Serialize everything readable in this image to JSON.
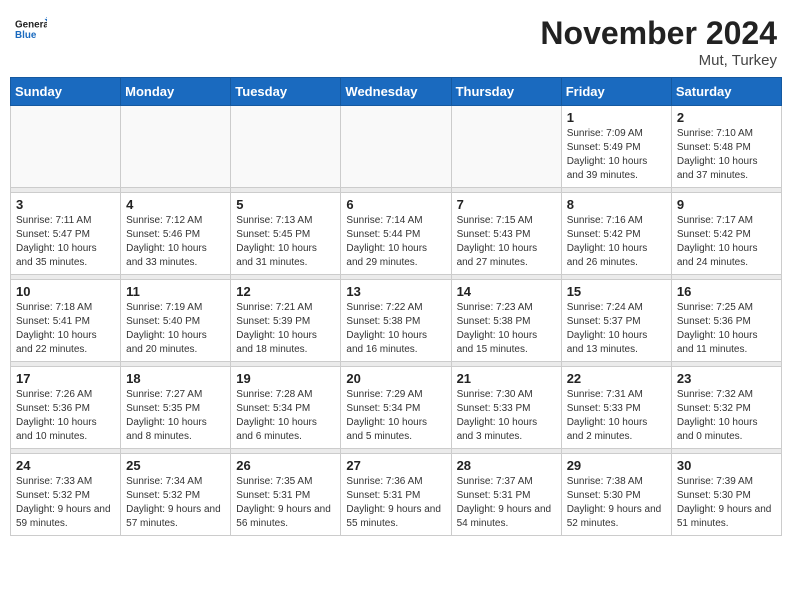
{
  "header": {
    "logo_text_general": "General",
    "logo_text_blue": "Blue",
    "month_title": "November 2024",
    "location": "Mut, Turkey"
  },
  "weekdays": [
    "Sunday",
    "Monday",
    "Tuesday",
    "Wednesday",
    "Thursday",
    "Friday",
    "Saturday"
  ],
  "weeks": [
    [
      {
        "day": "",
        "info": ""
      },
      {
        "day": "",
        "info": ""
      },
      {
        "day": "",
        "info": ""
      },
      {
        "day": "",
        "info": ""
      },
      {
        "day": "",
        "info": ""
      },
      {
        "day": "1",
        "info": "Sunrise: 7:09 AM\nSunset: 5:49 PM\nDaylight: 10 hours and 39 minutes."
      },
      {
        "day": "2",
        "info": "Sunrise: 7:10 AM\nSunset: 5:48 PM\nDaylight: 10 hours and 37 minutes."
      }
    ],
    [
      {
        "day": "3",
        "info": "Sunrise: 7:11 AM\nSunset: 5:47 PM\nDaylight: 10 hours and 35 minutes."
      },
      {
        "day": "4",
        "info": "Sunrise: 7:12 AM\nSunset: 5:46 PM\nDaylight: 10 hours and 33 minutes."
      },
      {
        "day": "5",
        "info": "Sunrise: 7:13 AM\nSunset: 5:45 PM\nDaylight: 10 hours and 31 minutes."
      },
      {
        "day": "6",
        "info": "Sunrise: 7:14 AM\nSunset: 5:44 PM\nDaylight: 10 hours and 29 minutes."
      },
      {
        "day": "7",
        "info": "Sunrise: 7:15 AM\nSunset: 5:43 PM\nDaylight: 10 hours and 27 minutes."
      },
      {
        "day": "8",
        "info": "Sunrise: 7:16 AM\nSunset: 5:42 PM\nDaylight: 10 hours and 26 minutes."
      },
      {
        "day": "9",
        "info": "Sunrise: 7:17 AM\nSunset: 5:42 PM\nDaylight: 10 hours and 24 minutes."
      }
    ],
    [
      {
        "day": "10",
        "info": "Sunrise: 7:18 AM\nSunset: 5:41 PM\nDaylight: 10 hours and 22 minutes."
      },
      {
        "day": "11",
        "info": "Sunrise: 7:19 AM\nSunset: 5:40 PM\nDaylight: 10 hours and 20 minutes."
      },
      {
        "day": "12",
        "info": "Sunrise: 7:21 AM\nSunset: 5:39 PM\nDaylight: 10 hours and 18 minutes."
      },
      {
        "day": "13",
        "info": "Sunrise: 7:22 AM\nSunset: 5:38 PM\nDaylight: 10 hours and 16 minutes."
      },
      {
        "day": "14",
        "info": "Sunrise: 7:23 AM\nSunset: 5:38 PM\nDaylight: 10 hours and 15 minutes."
      },
      {
        "day": "15",
        "info": "Sunrise: 7:24 AM\nSunset: 5:37 PM\nDaylight: 10 hours and 13 minutes."
      },
      {
        "day": "16",
        "info": "Sunrise: 7:25 AM\nSunset: 5:36 PM\nDaylight: 10 hours and 11 minutes."
      }
    ],
    [
      {
        "day": "17",
        "info": "Sunrise: 7:26 AM\nSunset: 5:36 PM\nDaylight: 10 hours and 10 minutes."
      },
      {
        "day": "18",
        "info": "Sunrise: 7:27 AM\nSunset: 5:35 PM\nDaylight: 10 hours and 8 minutes."
      },
      {
        "day": "19",
        "info": "Sunrise: 7:28 AM\nSunset: 5:34 PM\nDaylight: 10 hours and 6 minutes."
      },
      {
        "day": "20",
        "info": "Sunrise: 7:29 AM\nSunset: 5:34 PM\nDaylight: 10 hours and 5 minutes."
      },
      {
        "day": "21",
        "info": "Sunrise: 7:30 AM\nSunset: 5:33 PM\nDaylight: 10 hours and 3 minutes."
      },
      {
        "day": "22",
        "info": "Sunrise: 7:31 AM\nSunset: 5:33 PM\nDaylight: 10 hours and 2 minutes."
      },
      {
        "day": "23",
        "info": "Sunrise: 7:32 AM\nSunset: 5:32 PM\nDaylight: 10 hours and 0 minutes."
      }
    ],
    [
      {
        "day": "24",
        "info": "Sunrise: 7:33 AM\nSunset: 5:32 PM\nDaylight: 9 hours and 59 minutes."
      },
      {
        "day": "25",
        "info": "Sunrise: 7:34 AM\nSunset: 5:32 PM\nDaylight: 9 hours and 57 minutes."
      },
      {
        "day": "26",
        "info": "Sunrise: 7:35 AM\nSunset: 5:31 PM\nDaylight: 9 hours and 56 minutes."
      },
      {
        "day": "27",
        "info": "Sunrise: 7:36 AM\nSunset: 5:31 PM\nDaylight: 9 hours and 55 minutes."
      },
      {
        "day": "28",
        "info": "Sunrise: 7:37 AM\nSunset: 5:31 PM\nDaylight: 9 hours and 54 minutes."
      },
      {
        "day": "29",
        "info": "Sunrise: 7:38 AM\nSunset: 5:30 PM\nDaylight: 9 hours and 52 minutes."
      },
      {
        "day": "30",
        "info": "Sunrise: 7:39 AM\nSunset: 5:30 PM\nDaylight: 9 hours and 51 minutes."
      }
    ]
  ]
}
